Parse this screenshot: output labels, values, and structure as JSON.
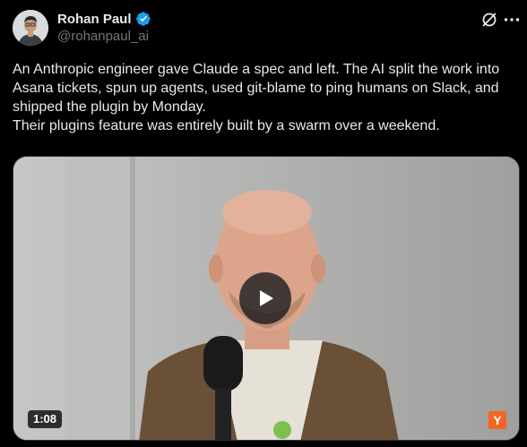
{
  "author": {
    "name": "Rohan Paul",
    "handle": "@rohanpaul_ai",
    "verified": true,
    "verified_color": "#1d9bf0"
  },
  "actions": {
    "grok_icon": "grok-icon",
    "more_icon": "more-horizontal-icon"
  },
  "tweet": {
    "paragraph1": "An Anthropic engineer gave Claude a spec and left. The AI split the work into Asana tickets, spun up agents, used git-blame to ping humans on Slack, and shipped the plugin by Monday.",
    "paragraph2": "Their plugins feature was entirely built by a swarm over a weekend."
  },
  "video": {
    "duration": "1:08",
    "channel_logo": "Y",
    "channel_logo_color": "#f26522"
  },
  "colors": {
    "background": "#000000",
    "text_primary": "#e7e9ea",
    "text_secondary": "#71767b"
  }
}
